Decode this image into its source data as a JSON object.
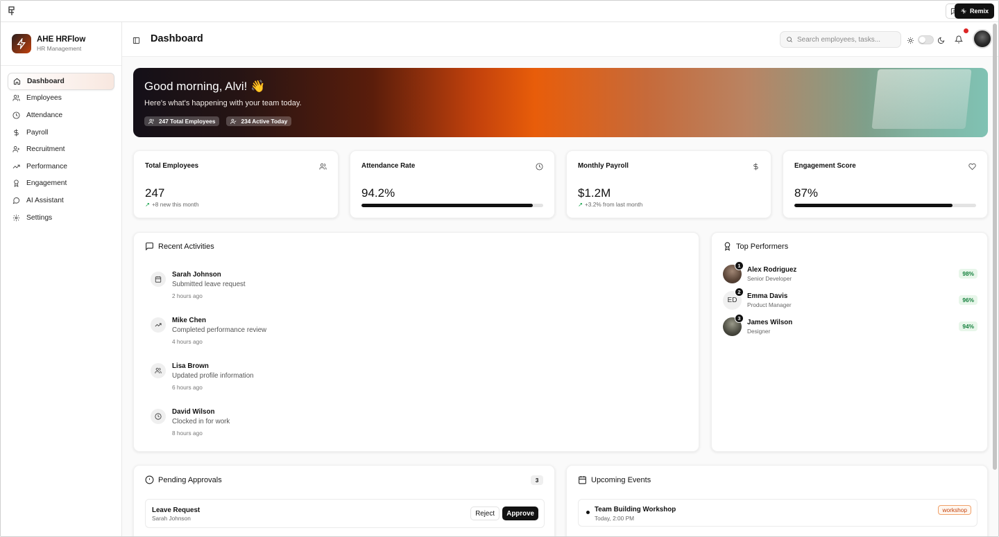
{
  "sidebar": {
    "brand_title": "AHE HRFlow",
    "brand_subtitle": "HR Management",
    "items": [
      {
        "label": "Dashboard",
        "icon": "home-icon"
      },
      {
        "label": "Employees",
        "icon": "users-icon"
      },
      {
        "label": "Attendance",
        "icon": "clock-icon"
      },
      {
        "label": "Payroll",
        "icon": "dollar-icon"
      },
      {
        "label": "Recruitment",
        "icon": "user-plus-icon"
      },
      {
        "label": "Performance",
        "icon": "trending-up-icon"
      },
      {
        "label": "Engagement",
        "icon": "award-icon"
      },
      {
        "label": "AI Assistant",
        "icon": "message-circle-icon"
      },
      {
        "label": "Settings",
        "icon": "gear-icon"
      }
    ],
    "active_index": 0
  },
  "topbar": {
    "remix_label": "Remix"
  },
  "header": {
    "title": "Dashboard",
    "search_placeholder": "Search employees, tasks..."
  },
  "hero": {
    "greeting": "Good morning, Alvi! 👋",
    "subtitle": "Here's what's happening with your team today.",
    "badges": [
      "247 Total Employees",
      "234 Active Today"
    ]
  },
  "stats": [
    {
      "label": "Total Employees",
      "value": "247",
      "trend": "+8 new this month",
      "icon": "users-icon"
    },
    {
      "label": "Attendance Rate",
      "value": "94.2%",
      "progress": 0.942,
      "icon": "clock-icon"
    },
    {
      "label": "Monthly Payroll",
      "value": "$1.2M",
      "trend": "+3.2% from last month",
      "icon": "dollar-icon"
    },
    {
      "label": "Engagement Score",
      "value": "87%",
      "progress": 0.87,
      "icon": "heart-icon"
    }
  ],
  "activities": {
    "title": "Recent Activities",
    "items": [
      {
        "name": "Sarah Johnson",
        "desc": "Submitted leave request",
        "time": "2 hours ago",
        "icon": "calendar-icon"
      },
      {
        "name": "Mike Chen",
        "desc": "Completed performance review",
        "time": "4 hours ago",
        "icon": "trending-up-icon"
      },
      {
        "name": "Lisa Brown",
        "desc": "Updated profile information",
        "time": "6 hours ago",
        "icon": "users-icon"
      },
      {
        "name": "David Wilson",
        "desc": "Clocked in for work",
        "time": "8 hours ago",
        "icon": "clock-icon"
      }
    ]
  },
  "performers": {
    "title": "Top Performers",
    "items": [
      {
        "rank": "1",
        "name": "Alex Rodriguez",
        "role": "Senior Developer",
        "score": "98%"
      },
      {
        "rank": "2",
        "name": "Emma Davis",
        "role": "Product Manager",
        "score": "96%",
        "initials": "ED"
      },
      {
        "rank": "3",
        "name": "James Wilson",
        "role": "Designer",
        "score": "94%"
      }
    ]
  },
  "approvals": {
    "title": "Pending Approvals",
    "count": "3",
    "items": [
      {
        "title": "Leave Request",
        "subtitle": "Sarah Johnson",
        "reject_label": "Reject",
        "approve_label": "Approve"
      }
    ]
  },
  "events": {
    "title": "Upcoming Events",
    "items": [
      {
        "title": "Team Building Workshop",
        "subtitle": "Today, 2:00 PM",
        "tag": "workshop"
      }
    ]
  }
}
